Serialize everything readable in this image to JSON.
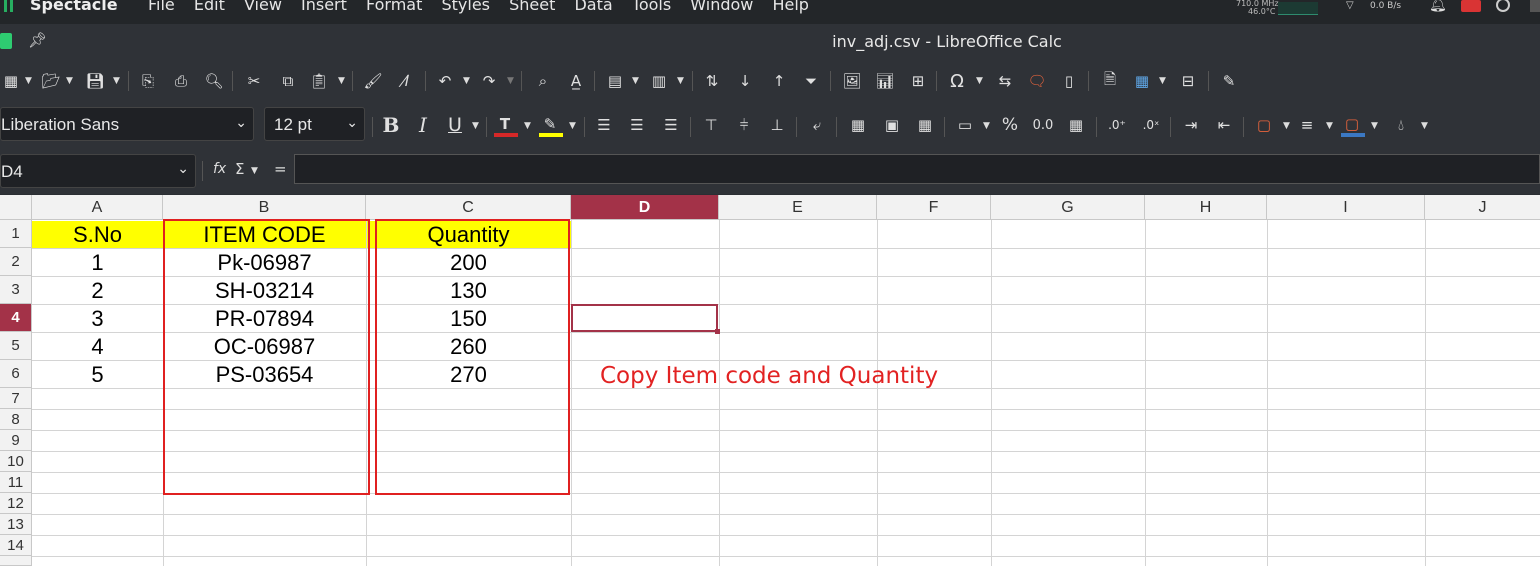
{
  "system_bar": {
    "app_name": "Spectacle",
    "menu": [
      "File",
      "Edit",
      "View",
      "Insert",
      "Format",
      "Styles",
      "Sheet",
      "Data",
      "Tools",
      "Window",
      "Help"
    ],
    "cpu_freq": "710.0 MHz",
    "cpu_temp": "46.0°C",
    "net_speed": "0.0 B/s"
  },
  "window": {
    "title": "inv_adj.csv - LibreOffice Calc"
  },
  "format_bar": {
    "font_name": "Liberation Sans",
    "font_size": "12 pt"
  },
  "formula_bar": {
    "name_box": "D4",
    "function_wizard": "fx",
    "sum_symbol": "Σ",
    "equals_symbol": "=",
    "formula_value": ""
  },
  "sheet": {
    "columns": [
      "A",
      "B",
      "C",
      "D",
      "E",
      "F",
      "G",
      "H",
      "I",
      "J"
    ],
    "rows": [
      "1",
      "2",
      "3",
      "4",
      "5",
      "6",
      "7",
      "8",
      "9",
      "10",
      "11",
      "12",
      "13",
      "14"
    ],
    "active_cell": "D4",
    "headers": {
      "a": "S.No",
      "b": "ITEM CODE",
      "c": "Quantity"
    },
    "data": [
      {
        "sno": "1",
        "code": "Pk-06987",
        "qty": "200"
      },
      {
        "sno": "2",
        "code": "SH-03214",
        "qty": "130"
      },
      {
        "sno": "3",
        "code": "PR-07894",
        "qty": "150"
      },
      {
        "sno": "4",
        "code": "OC-06987",
        "qty": "260"
      },
      {
        "sno": "5",
        "code": "PS-03654",
        "qty": "270"
      }
    ],
    "annotation": "Copy Item code and Quantity",
    "header_fill_color": "#ffff00",
    "annotation_color": "#e22222",
    "active_color": "#a33248"
  }
}
